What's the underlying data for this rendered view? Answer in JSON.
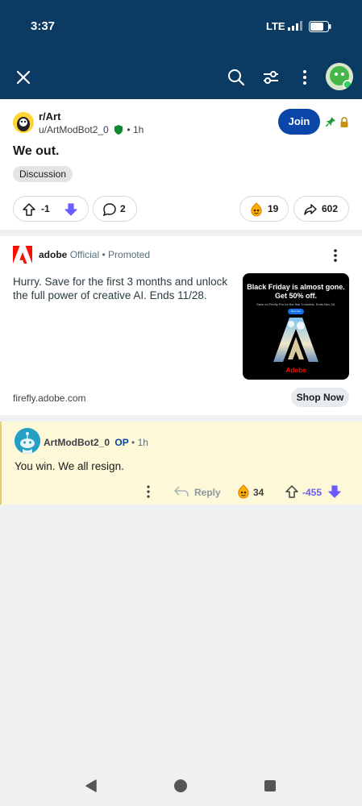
{
  "status_bar": {
    "time": "3:37",
    "network": "LTE"
  },
  "app_bar": {
    "close_icon": "close-icon",
    "search_icon": "search-icon",
    "sort_icon": "sort-icon",
    "more_icon": "more-vertical-icon"
  },
  "post": {
    "subreddit": "r/Art",
    "author": "u/ArtModBot2_0",
    "separator": "•",
    "age": "1h",
    "title": "We out.",
    "flair": "Discussion",
    "join_label": "Join",
    "score": "-1",
    "comments": "2",
    "awards": "19",
    "shares": "602"
  },
  "ad": {
    "brand": "adobe",
    "official": "Official",
    "promoted": "• Promoted",
    "body": "Hurry. Save for the first 3 months and unlock the full power of creative AI. Ends 11/28.",
    "image_headline_1": "Black Friday is almost gone.",
    "image_headline_2": "Get 50% off.",
    "image_small": "Save on Firefly Pro for the first 3 months. Ends Nov 28.",
    "image_cta": "Buy now",
    "image_wordmark": "Adobe",
    "domain": "firefly.adobe.com",
    "cta": "Shop Now",
    "accent": "#fa0f00"
  },
  "comment": {
    "author": "ArtModBot2_0",
    "op_badge": "OP",
    "age": "• 1h",
    "body": "You win. We all resign.",
    "reply_label": "Reply",
    "awards": "34",
    "score": "-455",
    "score_color": "#6a5cff"
  },
  "colors": {
    "header_bg": "#0b3a63",
    "join_bg": "#0a45a8",
    "comment_highlight": "#fdf8d7"
  }
}
